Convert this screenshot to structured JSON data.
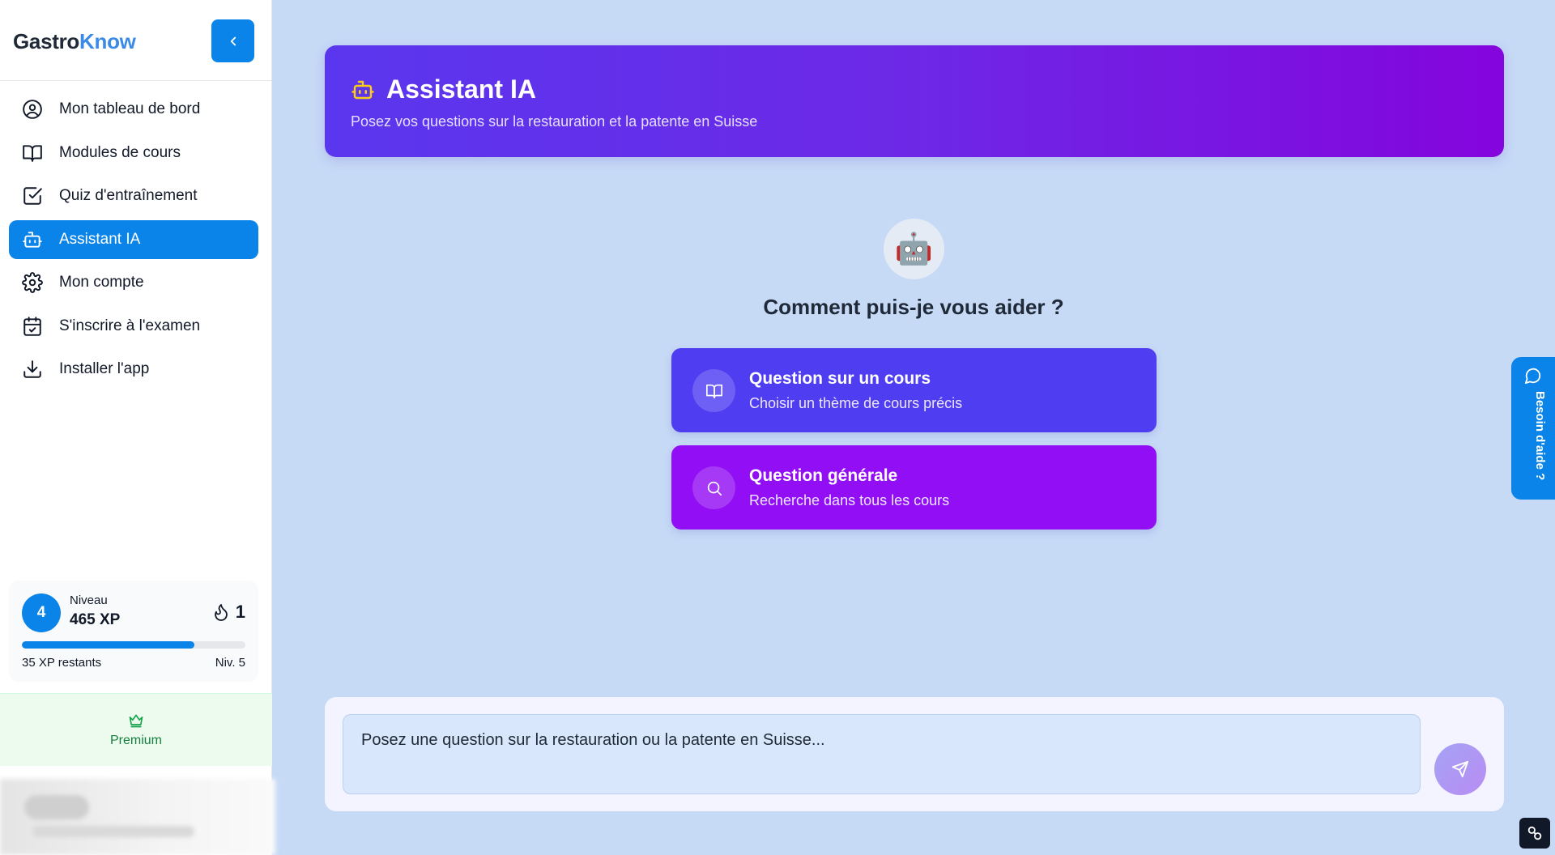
{
  "sidebar": {
    "logo": {
      "part1": "Gastro",
      "part2": "Know"
    },
    "collapse_icon": "chevron-left-icon",
    "nav_items": [
      {
        "label": "Mon tableau de bord",
        "icon": "user-circle-icon",
        "active": false
      },
      {
        "label": "Modules de cours",
        "icon": "book-open-icon",
        "active": false
      },
      {
        "label": "Quiz d'entraînement",
        "icon": "check-square-icon",
        "active": false
      },
      {
        "label": "Assistant IA",
        "icon": "bot-icon",
        "active": true
      },
      {
        "label": "Mon compte",
        "icon": "gear-icon",
        "active": false
      },
      {
        "label": "S'inscrire à l'examen",
        "icon": "calendar-check-icon",
        "active": false
      },
      {
        "label": "Installer l'app",
        "icon": "download-icon",
        "active": false
      }
    ],
    "level_card": {
      "level": "4",
      "label": "Niveau",
      "xp": "465 XP",
      "streak": "1",
      "progress_percent": 77,
      "remaining": "35 XP restants",
      "next_level": "Niv. 5"
    },
    "premium": {
      "label": "Premium",
      "icon": "crown-icon"
    }
  },
  "header": {
    "icon": "bot-icon",
    "title": "Assistant IA",
    "subtitle": "Posez vos questions sur la restauration et la patente en Suisse"
  },
  "main": {
    "bot_emoji": "🤖",
    "help_title": "Comment puis-je vous aider ?",
    "options": [
      {
        "title": "Question sur un cours",
        "subtitle": "Choisir un thème de cours précis",
        "icon": "book-open-icon",
        "color": "#4f3df2"
      },
      {
        "title": "Question générale",
        "subtitle": "Recherche dans tous les cours",
        "icon": "search-icon",
        "color": "#920ef4"
      }
    ]
  },
  "help_tab": {
    "label": "Besoin d'aide ?",
    "icon": "chat-bubble-icon"
  },
  "chat": {
    "placeholder": "Posez une question sur la restauration ou la patente en Suisse...",
    "send_icon": "send-icon"
  },
  "colors": {
    "primary": "#0a84e8",
    "background": "#c6daf6",
    "accent_purple": "#8405dd"
  }
}
